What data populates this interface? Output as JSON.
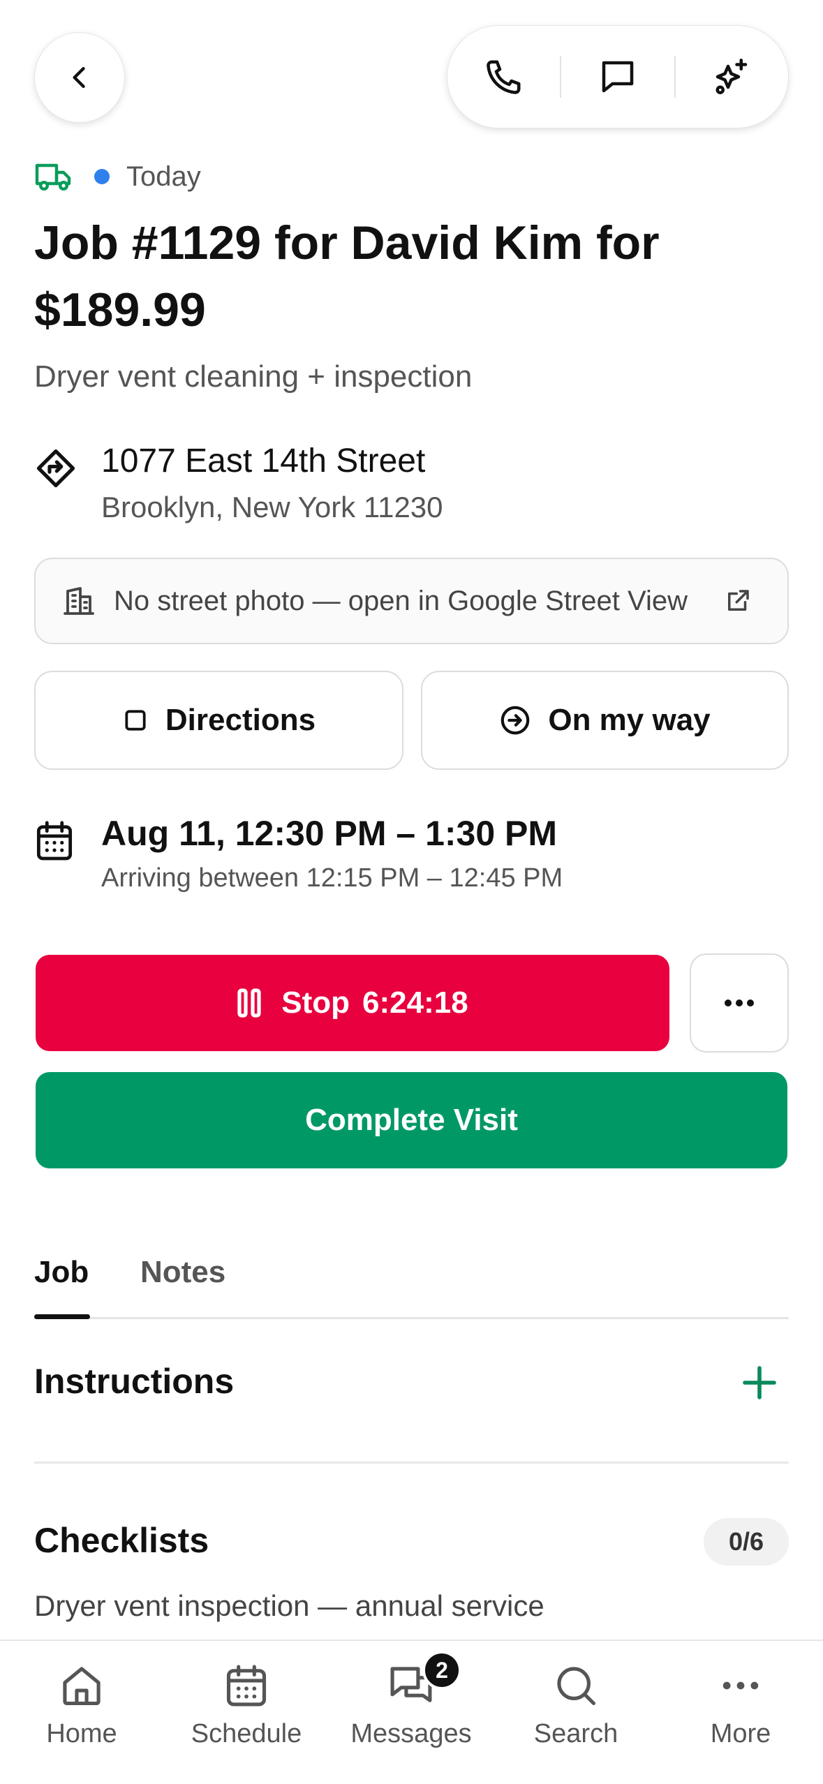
{
  "header": {
    "back_icon": "chevron-left-icon",
    "actions": [
      {
        "name": "phone",
        "icon": "phone-icon"
      },
      {
        "name": "message",
        "icon": "chat-bubble-icon"
      },
      {
        "name": "ai",
        "icon": "sparkles-icon"
      }
    ]
  },
  "status": {
    "vehicle_icon": "truck-icon",
    "vehicle_color": "#0a9c5a",
    "dot_color": "#2f80ed",
    "label": "Today"
  },
  "job": {
    "title": "Job #1129 for David Kim for $189.99",
    "description": "Dryer vent cleaning + inspection"
  },
  "address": {
    "icon": "directions-diamond-icon",
    "line1": "1077 East 14th Street",
    "line2": "Brooklyn, New York 11230"
  },
  "street_view": {
    "icon": "building-icon",
    "label": "No street photo — open in Google Street View",
    "trailing_icon": "external-link-icon"
  },
  "buttons": {
    "directions_label": "Directions",
    "on_my_way_label": "On my way",
    "stop_label": "Stop",
    "timer": "6:24:18",
    "complete_label": "Complete Visit"
  },
  "schedule": {
    "icon": "calendar-icon",
    "window": "Aug 11, 12:30 PM – 1:30 PM",
    "arrival": "Arriving between 12:15 PM – 12:45 PM"
  },
  "tabs": [
    {
      "label": "Job",
      "active": true
    },
    {
      "label": "Notes",
      "active": false
    }
  ],
  "sections": {
    "instructions_title": "Instructions",
    "checklists_title": "Checklists",
    "checklists_progress": "0/6",
    "checklist_name": "Dryer vent inspection — annual service"
  },
  "colors": {
    "stop": "#e8003f",
    "complete": "#009966",
    "accent_green": "#0a8a5c"
  },
  "bottom_nav": [
    {
      "label": "Home",
      "icon": "home-icon"
    },
    {
      "label": "Schedule",
      "icon": "calendar-icon"
    },
    {
      "label": "Messages",
      "icon": "messages-icon",
      "badge": "2"
    },
    {
      "label": "Search",
      "icon": "search-icon"
    },
    {
      "label": "More",
      "icon": "more-horizontal-icon"
    }
  ]
}
